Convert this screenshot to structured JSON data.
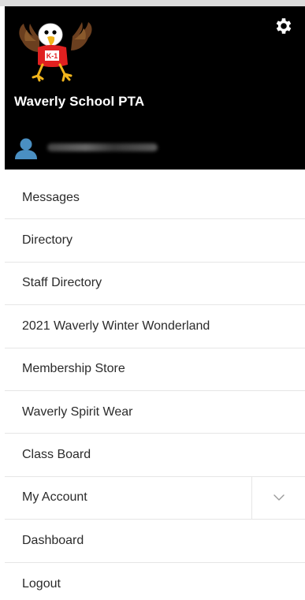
{
  "header": {
    "org_name": "Waverly School PTA",
    "logo": {
      "name": "eagle-mascot-logo",
      "shirt_text": "K-1"
    },
    "settings_icon": "gear-icon",
    "user": {
      "avatar_icon": "user-icon"
    }
  },
  "menu": {
    "items": [
      {
        "label": "Messages"
      },
      {
        "label": "Directory"
      },
      {
        "label": "Staff Directory"
      },
      {
        "label": "2021 Waverly Winter Wonderland"
      },
      {
        "label": "Membership Store"
      },
      {
        "label": "Waverly Spirit Wear"
      },
      {
        "label": "Class Board"
      },
      {
        "label": "My Account",
        "expand_icon": "chevron-down-icon"
      },
      {
        "label": "Dashboard"
      },
      {
        "label": "Logout"
      }
    ]
  },
  "colors": {
    "header_bg": "#000000",
    "header_text": "#ffffff",
    "avatar": "#4a8fc2",
    "menu_text": "#2b2b2b",
    "divider": "#e6e6e6",
    "shirt": "#e02020"
  }
}
